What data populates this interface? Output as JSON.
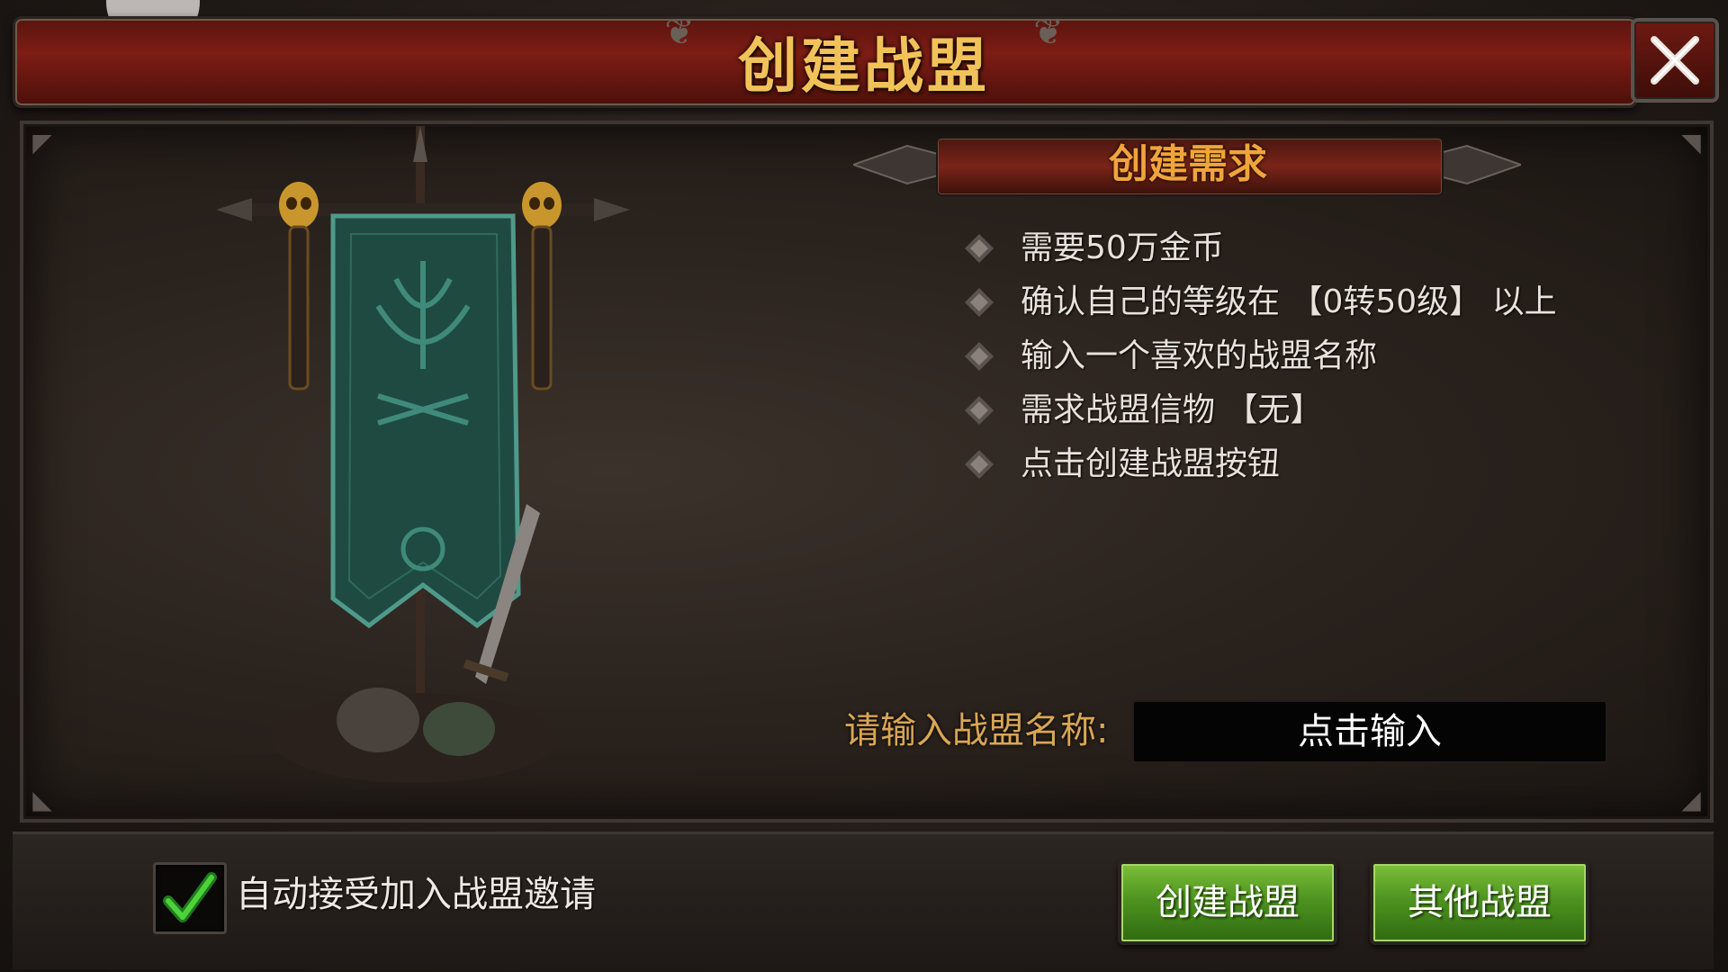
{
  "dialog": {
    "title": "创建战盟",
    "close_icon": "close-x-icon"
  },
  "requirements": {
    "header": "创建需求",
    "items": [
      "需要50万金币",
      "确认自己的等级在 【0转50级】 以上",
      "输入一个喜欢的战盟名称",
      "需求战盟信物 【无】",
      "点击创建战盟按钮"
    ]
  },
  "name_input": {
    "label": "请输入战盟名称:",
    "placeholder": "点击输入"
  },
  "footer": {
    "auto_accept_label": "自动接受加入战盟邀请",
    "auto_accept_checked": true,
    "create_button": "创建战盟",
    "other_button": "其他战盟"
  },
  "colors": {
    "title_gold": "#f2c25a",
    "header_orange": "#f0a43a",
    "label_gold": "#d9a655",
    "button_green": "#4e9420",
    "banner_teal": "#1f4a42",
    "title_bar_red": "#7d1d14"
  }
}
